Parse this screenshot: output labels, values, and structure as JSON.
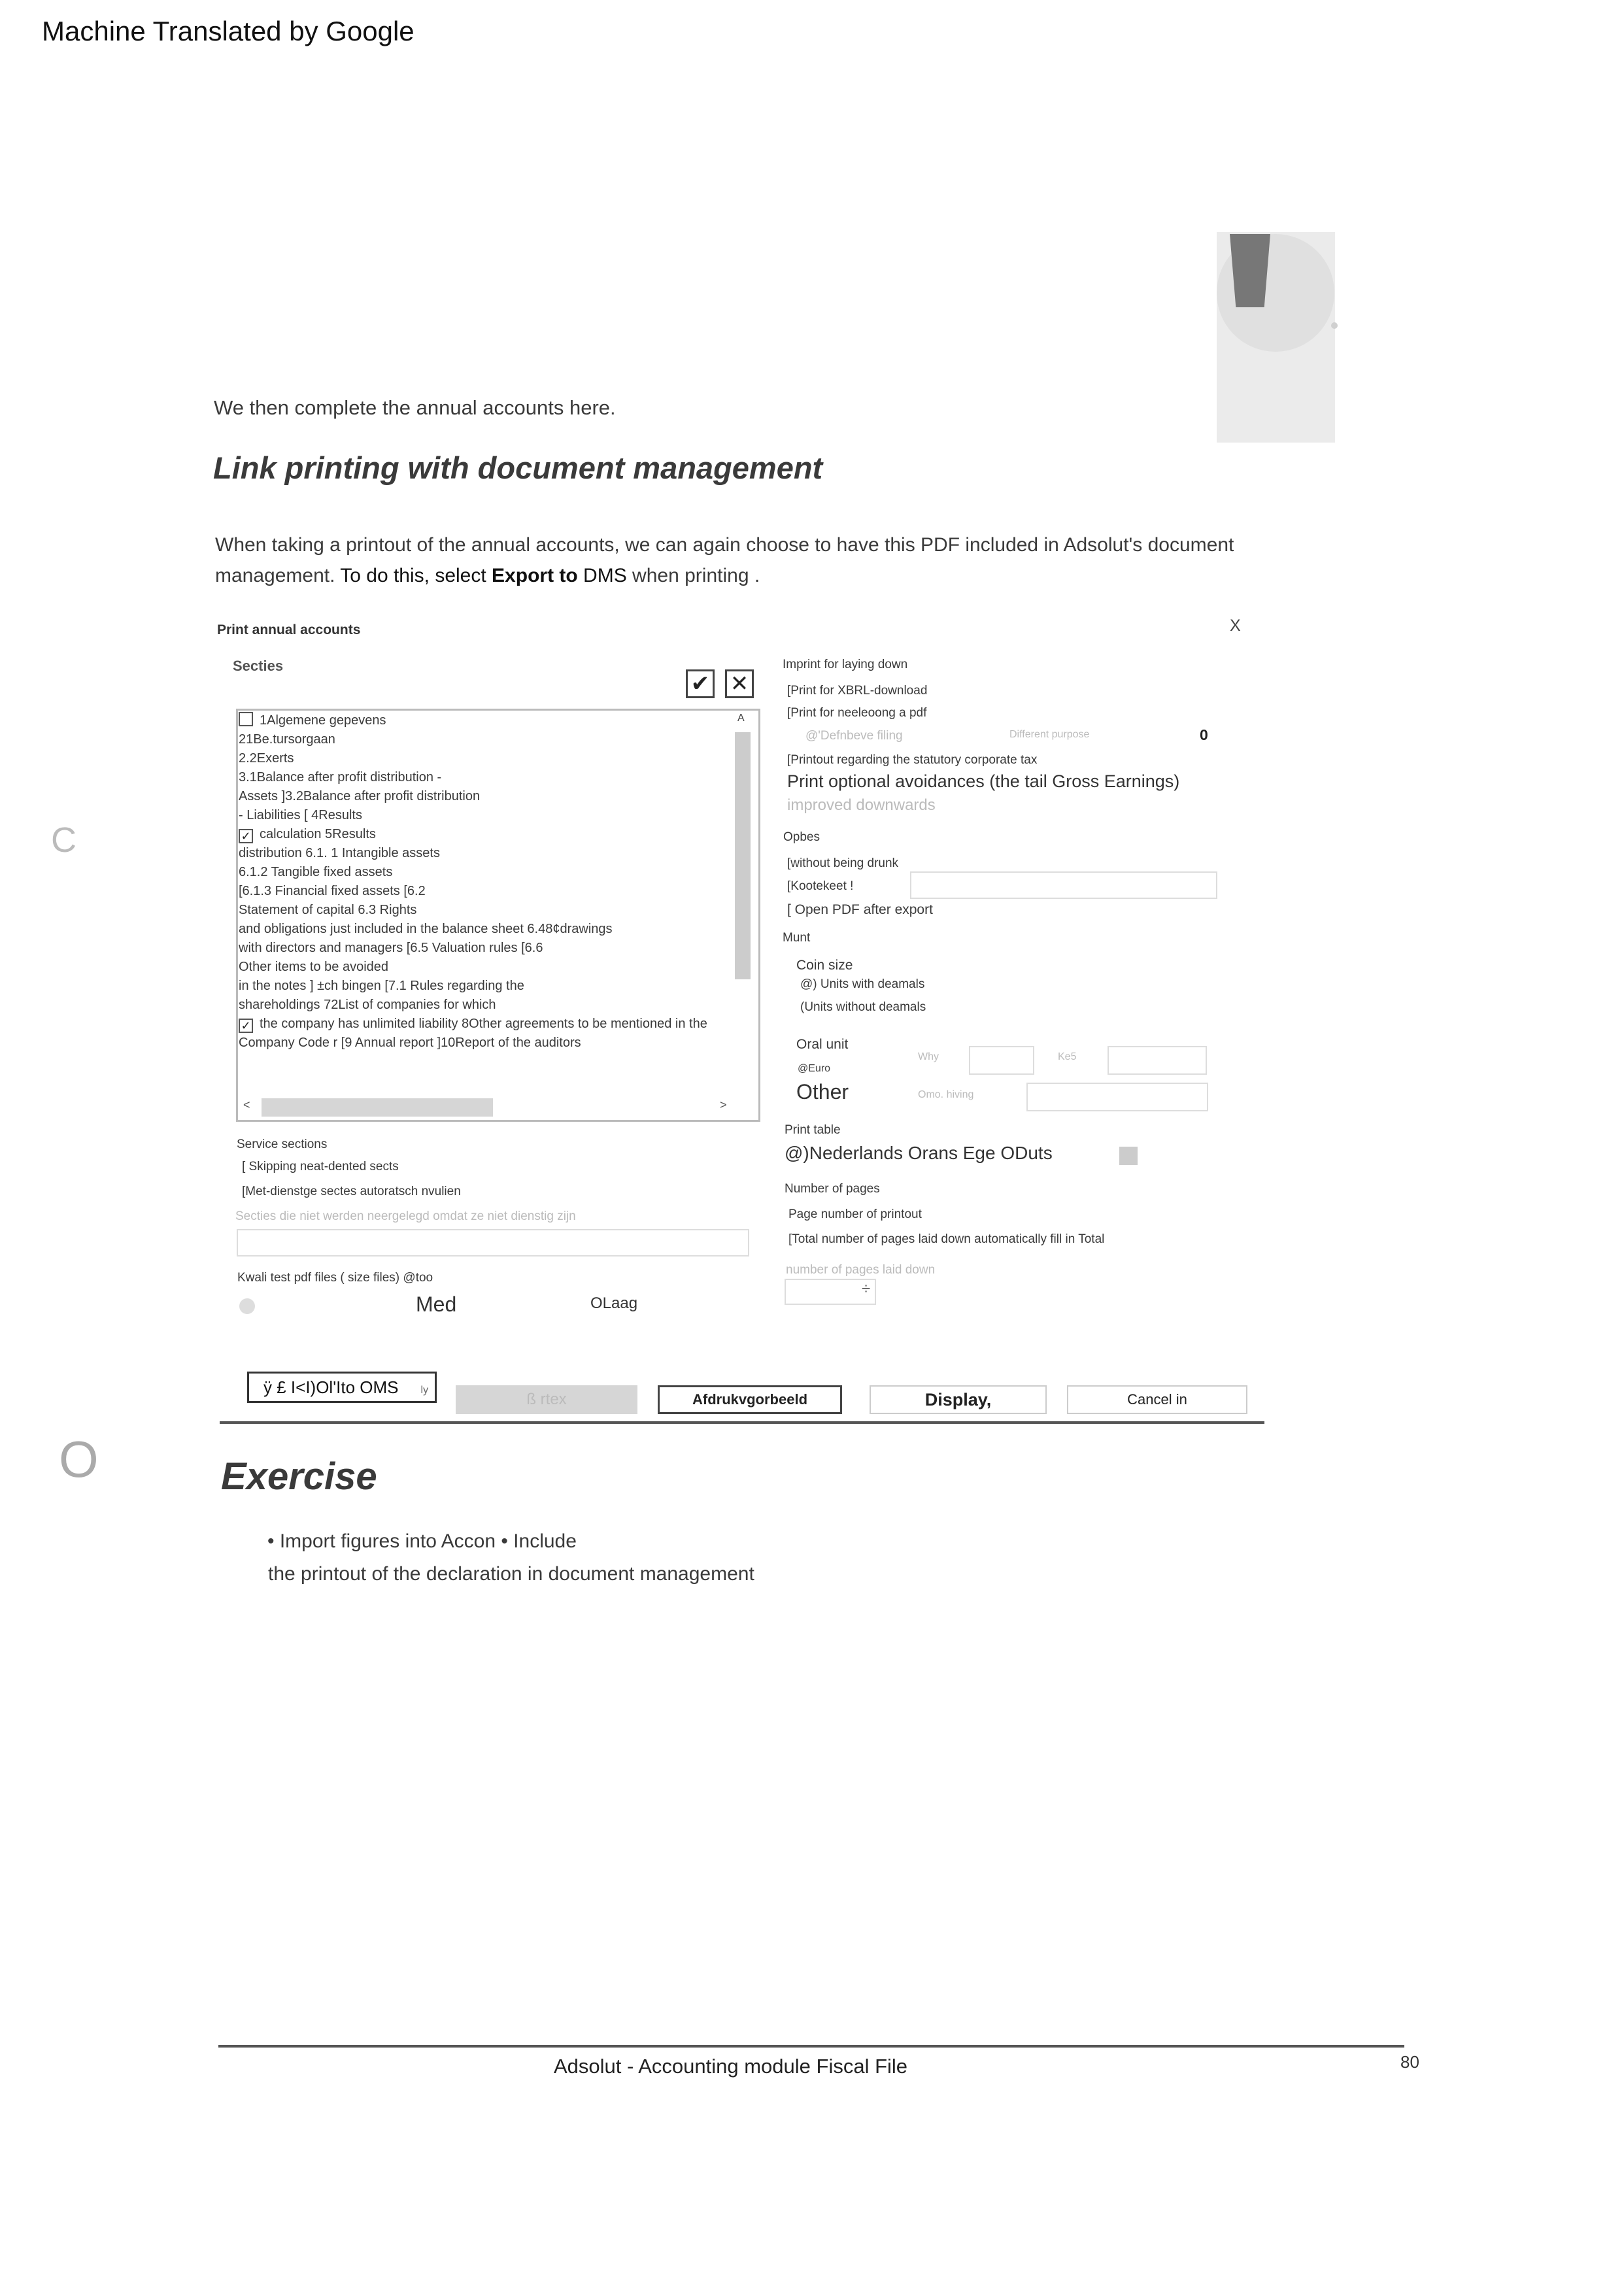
{
  "header": {
    "machine_translated": "Machine Translated by Google"
  },
  "intro": "We then complete the annual accounts here.",
  "heading": "Link printing with document management",
  "paragraph": {
    "part1": "When taking a printout of the annual accounts, we can again choose to have this PDF included in Adsolut's document management. ",
    "bold1": "To do this, select ",
    "bold2": "Export to",
    "bold3": " DMS",
    "part2": " when printing ."
  },
  "side_letters": {
    "c": "C",
    "o": "O"
  },
  "dialog": {
    "title": "Print annual accounts",
    "close": "X",
    "secties_label": "Secties",
    "check_all_icon": "✔",
    "clear_all_icon": "✕",
    "list_scroll_up": "A",
    "list_scroll_left": "<",
    "list_scroll_right": ">",
    "list_lines": [
      "1Algemene gepevens",
      "21Be.tursorgaan",
      "2.2Exerts",
      "3.1Balance after profit distribution -",
      "Assets ]3.2Balance after profit distribution",
      "- Liabilities [ 4Results",
      "calculation 5Results",
      "distribution 6.1. 1 Intangible assets",
      "6.1.2 Tangible fixed assets",
      "[6.1.3 Financial fixed assets [6.2",
      "Statement of capital 6.3 Rights",
      "and obligations just included in the balance sheet 6.48¢drawings",
      "with directors and managers [6.5 Valuation rules [6.6",
      "Other items to be avoided",
      "in the notes ] ±ch bingen [7.1 Rules regarding the",
      "shareholdings 72List of companies for which",
      "the company has unlimited liability 8Other agreements to be mentioned in the",
      "Company Code r [9 Annual report ]10Report of the auditors"
    ],
    "service_sections_label": "Service sections",
    "service_opt1": "[ Skipping neat-dented sects",
    "service_opt2": "[Met-dienstge sectes autoratsch nvulien",
    "service_faint": "Secties die niet werden neergelegd omdat ze niet dienstig zijn",
    "quality_label": "Kwali test pdf files ( size files) @too",
    "quality_med": "Med",
    "quality_low": "OLaag",
    "imprint_label": "Imprint for laying down",
    "imprint_xbrl": "[Print for XBRL-download",
    "imprint_pdf": "[Print for neeleoong a pdf",
    "imprint_default": "@'Defnbeve filing",
    "imprint_other": "Different purpose",
    "imprint_zero": "0",
    "imprint_statutory": "[Printout regarding the statutory corporate tax",
    "print_optional": "Print optional avoidances (the tail Gross Earnings)",
    "improved": "improved downwards",
    "opbes_label": "Opbes",
    "opbes_without": "[without being drunk",
    "opbes_kootekeet": "[Kootekeet !",
    "opbes_open_pdf": "[ Open PDF after export",
    "munt_label": "Munt",
    "coin_size": "Coin size",
    "units_dec": "@) Units with deamals",
    "units_nodec": "(Units without deamals",
    "oral_unit": "Oral unit",
    "why": "Why",
    "keb": "Ke5",
    "euro": "@Euro",
    "other": "Other",
    "omo": "Omo. hiving",
    "print_table_label": "Print table",
    "print_table_value": "@)Nederlands Orans Ege ODuts",
    "pages_label": "Number of pages",
    "page_number_printout": "Page number of printout",
    "total_pages": "[Total number of pages laid down automatically fill in Total",
    "pages_laid_down": "number of pages laid down",
    "stepper": "÷",
    "buttons": {
      "dms": "ÿ £ I<I)Ol'Ito OMS",
      "dms_suffix": "ly",
      "print": "ß rtex",
      "preview": "Afdrukvgorbeeld",
      "display": "Display,",
      "cancel": "Cancel in"
    }
  },
  "exercise": {
    "heading": "Exercise",
    "line1": "• Import figures into Accon • Include",
    "line2": "the printout of the declaration in document management"
  },
  "footer": {
    "text": "Adsolut - Accounting module Fiscal File",
    "page": "80"
  }
}
